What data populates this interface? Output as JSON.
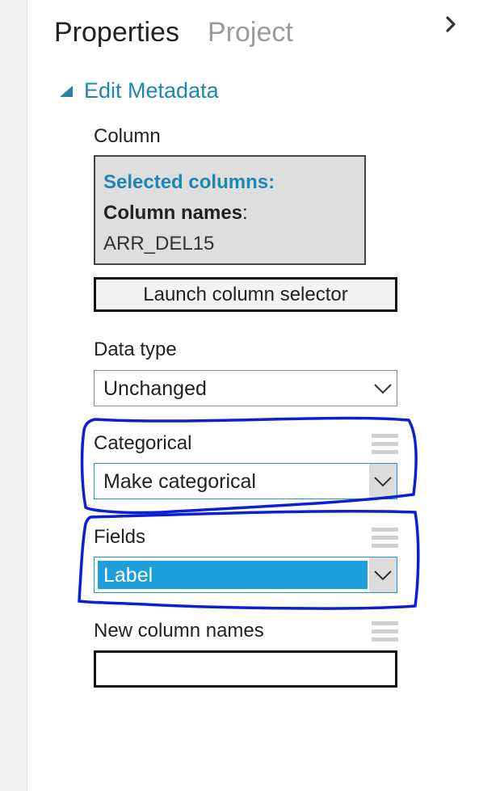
{
  "tabs": [
    {
      "label": "Properties",
      "active": true
    },
    {
      "label": "Project",
      "active": false
    }
  ],
  "collapse_icon": "chevron-right-icon",
  "section": {
    "title": "Edit Metadata",
    "expanded": true
  },
  "column": {
    "label": "Column",
    "selected_columns_title": "Selected columns:",
    "column_names_label": "Column names",
    "column_names_suffix": ":",
    "column_names_value": "ARR_DEL15",
    "launch_button_label": "Launch column selector"
  },
  "data_type": {
    "label": "Data type",
    "value": "Unchanged"
  },
  "categorical": {
    "label": "Categorical",
    "value": "Make categorical"
  },
  "fields": {
    "label": "Fields",
    "value": "Label"
  },
  "new_column_names": {
    "label": "New column names",
    "value": ""
  },
  "colors": {
    "accent": "#1d86b5",
    "selection": "#1e9fdb",
    "annotation": "#0a1fd6"
  }
}
